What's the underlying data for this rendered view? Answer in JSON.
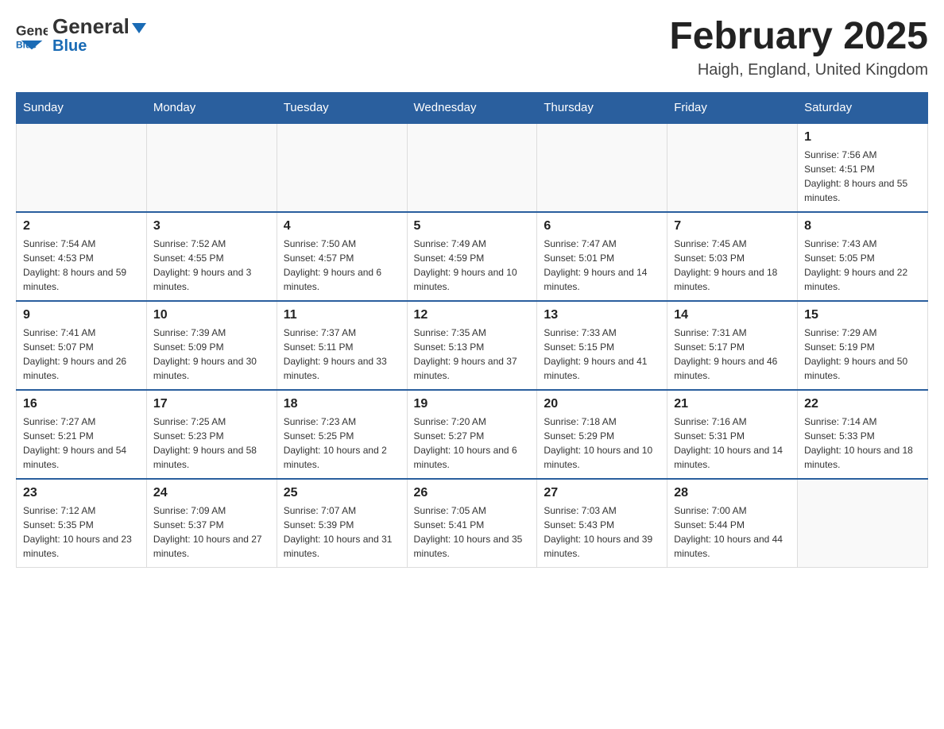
{
  "header": {
    "logo_general": "General",
    "logo_blue": "Blue",
    "title": "February 2025",
    "location": "Haigh, England, United Kingdom"
  },
  "calendar": {
    "days_of_week": [
      "Sunday",
      "Monday",
      "Tuesday",
      "Wednesday",
      "Thursday",
      "Friday",
      "Saturday"
    ],
    "weeks": [
      [
        {
          "day": "",
          "info": ""
        },
        {
          "day": "",
          "info": ""
        },
        {
          "day": "",
          "info": ""
        },
        {
          "day": "",
          "info": ""
        },
        {
          "day": "",
          "info": ""
        },
        {
          "day": "",
          "info": ""
        },
        {
          "day": "1",
          "info": "Sunrise: 7:56 AM\nSunset: 4:51 PM\nDaylight: 8 hours and 55 minutes."
        }
      ],
      [
        {
          "day": "2",
          "info": "Sunrise: 7:54 AM\nSunset: 4:53 PM\nDaylight: 8 hours and 59 minutes."
        },
        {
          "day": "3",
          "info": "Sunrise: 7:52 AM\nSunset: 4:55 PM\nDaylight: 9 hours and 3 minutes."
        },
        {
          "day": "4",
          "info": "Sunrise: 7:50 AM\nSunset: 4:57 PM\nDaylight: 9 hours and 6 minutes."
        },
        {
          "day": "5",
          "info": "Sunrise: 7:49 AM\nSunset: 4:59 PM\nDaylight: 9 hours and 10 minutes."
        },
        {
          "day": "6",
          "info": "Sunrise: 7:47 AM\nSunset: 5:01 PM\nDaylight: 9 hours and 14 minutes."
        },
        {
          "day": "7",
          "info": "Sunrise: 7:45 AM\nSunset: 5:03 PM\nDaylight: 9 hours and 18 minutes."
        },
        {
          "day": "8",
          "info": "Sunrise: 7:43 AM\nSunset: 5:05 PM\nDaylight: 9 hours and 22 minutes."
        }
      ],
      [
        {
          "day": "9",
          "info": "Sunrise: 7:41 AM\nSunset: 5:07 PM\nDaylight: 9 hours and 26 minutes."
        },
        {
          "day": "10",
          "info": "Sunrise: 7:39 AM\nSunset: 5:09 PM\nDaylight: 9 hours and 30 minutes."
        },
        {
          "day": "11",
          "info": "Sunrise: 7:37 AM\nSunset: 5:11 PM\nDaylight: 9 hours and 33 minutes."
        },
        {
          "day": "12",
          "info": "Sunrise: 7:35 AM\nSunset: 5:13 PM\nDaylight: 9 hours and 37 minutes."
        },
        {
          "day": "13",
          "info": "Sunrise: 7:33 AM\nSunset: 5:15 PM\nDaylight: 9 hours and 41 minutes."
        },
        {
          "day": "14",
          "info": "Sunrise: 7:31 AM\nSunset: 5:17 PM\nDaylight: 9 hours and 46 minutes."
        },
        {
          "day": "15",
          "info": "Sunrise: 7:29 AM\nSunset: 5:19 PM\nDaylight: 9 hours and 50 minutes."
        }
      ],
      [
        {
          "day": "16",
          "info": "Sunrise: 7:27 AM\nSunset: 5:21 PM\nDaylight: 9 hours and 54 minutes."
        },
        {
          "day": "17",
          "info": "Sunrise: 7:25 AM\nSunset: 5:23 PM\nDaylight: 9 hours and 58 minutes."
        },
        {
          "day": "18",
          "info": "Sunrise: 7:23 AM\nSunset: 5:25 PM\nDaylight: 10 hours and 2 minutes."
        },
        {
          "day": "19",
          "info": "Sunrise: 7:20 AM\nSunset: 5:27 PM\nDaylight: 10 hours and 6 minutes."
        },
        {
          "day": "20",
          "info": "Sunrise: 7:18 AM\nSunset: 5:29 PM\nDaylight: 10 hours and 10 minutes."
        },
        {
          "day": "21",
          "info": "Sunrise: 7:16 AM\nSunset: 5:31 PM\nDaylight: 10 hours and 14 minutes."
        },
        {
          "day": "22",
          "info": "Sunrise: 7:14 AM\nSunset: 5:33 PM\nDaylight: 10 hours and 18 minutes."
        }
      ],
      [
        {
          "day": "23",
          "info": "Sunrise: 7:12 AM\nSunset: 5:35 PM\nDaylight: 10 hours and 23 minutes."
        },
        {
          "day": "24",
          "info": "Sunrise: 7:09 AM\nSunset: 5:37 PM\nDaylight: 10 hours and 27 minutes."
        },
        {
          "day": "25",
          "info": "Sunrise: 7:07 AM\nSunset: 5:39 PM\nDaylight: 10 hours and 31 minutes."
        },
        {
          "day": "26",
          "info": "Sunrise: 7:05 AM\nSunset: 5:41 PM\nDaylight: 10 hours and 35 minutes."
        },
        {
          "day": "27",
          "info": "Sunrise: 7:03 AM\nSunset: 5:43 PM\nDaylight: 10 hours and 39 minutes."
        },
        {
          "day": "28",
          "info": "Sunrise: 7:00 AM\nSunset: 5:44 PM\nDaylight: 10 hours and 44 minutes."
        },
        {
          "day": "",
          "info": ""
        }
      ]
    ]
  }
}
